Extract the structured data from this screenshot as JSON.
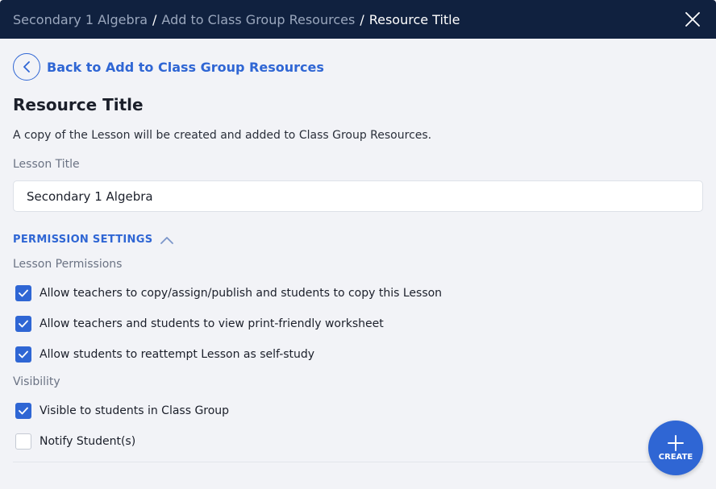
{
  "breadcrumb": {
    "items": [
      "Secondary 1 Algebra",
      "Add to Class Group Resources"
    ],
    "current": "Resource Title",
    "separator": "/"
  },
  "back_link": {
    "label": "Back to Add to Class Group Resources"
  },
  "page": {
    "title": "Resource Title",
    "description": "A copy of the Lesson will be created and added to Class Group Resources."
  },
  "lesson_title_field": {
    "label": "Lesson Title",
    "value": "Secondary 1 Algebra"
  },
  "permission_settings": {
    "toggle_label": "PERMISSION SETTINGS",
    "expanded": true,
    "lesson_permissions_label": "Lesson Permissions",
    "lesson_permissions": [
      {
        "label": "Allow teachers to copy/assign/publish and students to copy this Lesson",
        "checked": true
      },
      {
        "label": "Allow teachers and students to view print-friendly worksheet",
        "checked": true
      },
      {
        "label": "Allow students to reattempt Lesson as self-study",
        "checked": true
      }
    ],
    "visibility_label": "Visibility",
    "visibility": [
      {
        "label": "Visible to students in Class Group",
        "checked": true
      },
      {
        "label": "Notify Student(s)",
        "checked": false
      }
    ]
  },
  "create_button": {
    "label": "CREATE",
    "icon": "plus-icon"
  },
  "colors": {
    "header_bg": "#10213f",
    "accent": "#2f66d4",
    "background": "#f2f3f7"
  }
}
